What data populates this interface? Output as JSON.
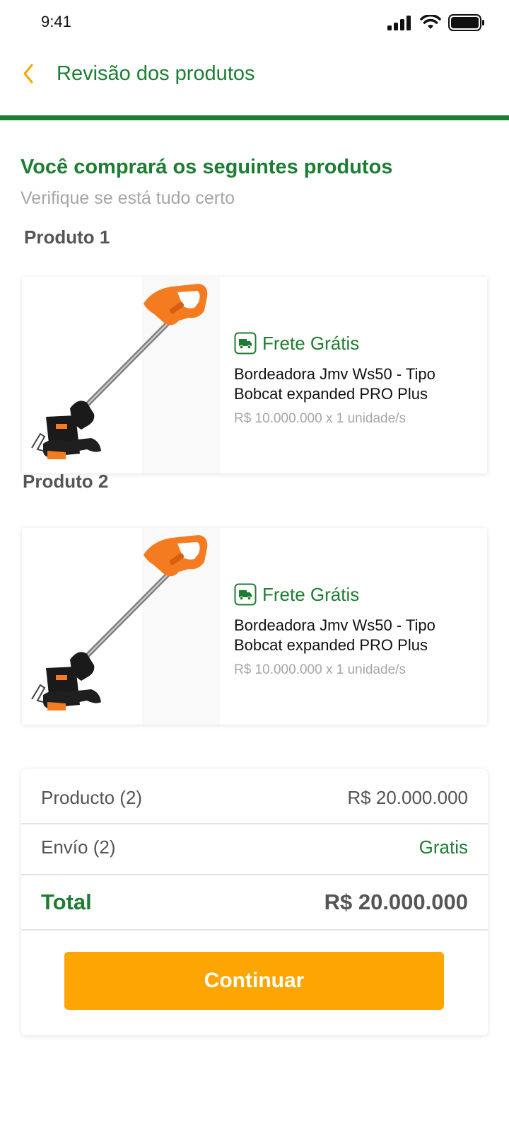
{
  "status_bar": {
    "time": "9:41"
  },
  "header": {
    "title": "Revisão dos produtos",
    "back_icon": "chevron-left-icon"
  },
  "intro": {
    "title": "Você comprará os seguintes produtos",
    "subtitle": "Verifique se está tudo certo"
  },
  "products": [
    {
      "heading": "Produto 1",
      "shipping_label": "Frete Grátis",
      "name_line1": "Bordeadora Jmv Ws50 - Tipo",
      "name_line2": "Bobcat expanded PRO Plus",
      "price": "R$ 10.000.000 x 1 unidade/s"
    },
    {
      "heading": "Produto 2",
      "shipping_label": "Frete Grátis",
      "name_line1": "Bordeadora Jmv Ws50 - Tipo",
      "name_line2": "Bobcat expanded PRO Plus",
      "price": "R$ 10.000.000 x 1 unidade/s"
    }
  ],
  "summary": {
    "product_label": "Producto (2)",
    "product_value": "R$ 20.000.000",
    "shipping_label": "Envío (2)",
    "shipping_value": "Gratis",
    "total_label": "Total",
    "total_value": "R$ 20.000.000",
    "continue_label": "Continuar"
  },
  "colors": {
    "brand_green": "#1e7d32",
    "accent_orange": "#fca503",
    "muted_gray": "#a6a6a6"
  }
}
